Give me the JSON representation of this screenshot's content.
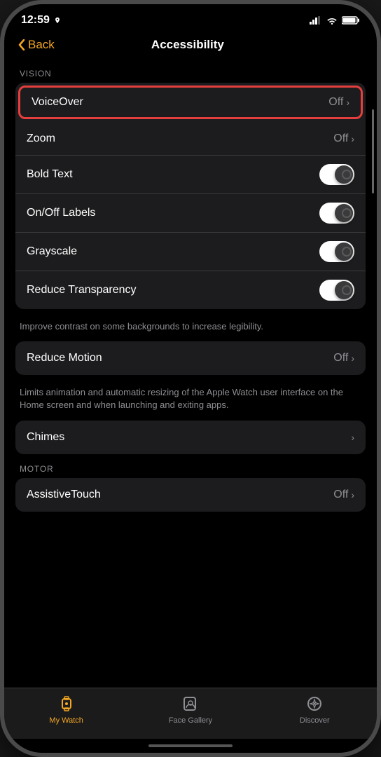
{
  "statusBar": {
    "time": "12:59",
    "locationIcon": "location-icon"
  },
  "navigation": {
    "backLabel": "Back",
    "pageTitle": "Accessibility"
  },
  "sections": {
    "vision": {
      "sectionLabel": "VISION",
      "items": [
        {
          "id": "voiceover",
          "label": "VoiceOver",
          "value": "Off",
          "type": "link",
          "highlighted": true
        },
        {
          "id": "zoom",
          "label": "Zoom",
          "value": "Off",
          "type": "link"
        },
        {
          "id": "bold-text",
          "label": "Bold Text",
          "value": "",
          "type": "toggle",
          "enabled": true
        },
        {
          "id": "onoff-labels",
          "label": "On/Off Labels",
          "value": "",
          "type": "toggle",
          "enabled": true
        },
        {
          "id": "grayscale",
          "label": "Grayscale",
          "value": "",
          "type": "toggle",
          "enabled": true
        },
        {
          "id": "reduce-transparency",
          "label": "Reduce Transparency",
          "value": "",
          "type": "toggle",
          "enabled": true
        }
      ],
      "description": "Improve contrast on some backgrounds to increase legibility."
    },
    "motion": {
      "items": [
        {
          "id": "reduce-motion",
          "label": "Reduce Motion",
          "value": "Off",
          "type": "link"
        }
      ],
      "description": "Limits animation and automatic resizing of the Apple Watch user interface on the Home screen and when launching and exiting apps."
    },
    "chimes": {
      "items": [
        {
          "id": "chimes",
          "label": "Chimes",
          "value": "",
          "type": "link"
        }
      ]
    },
    "motor": {
      "sectionLabel": "MOTOR",
      "items": [
        {
          "id": "assistive-touch",
          "label": "AssistiveTouch",
          "value": "Off",
          "type": "link"
        }
      ]
    }
  },
  "tabBar": {
    "items": [
      {
        "id": "my-watch",
        "label": "My Watch",
        "active": true
      },
      {
        "id": "face-gallery",
        "label": "Face Gallery",
        "active": false
      },
      {
        "id": "discover",
        "label": "Discover",
        "active": false
      }
    ]
  }
}
